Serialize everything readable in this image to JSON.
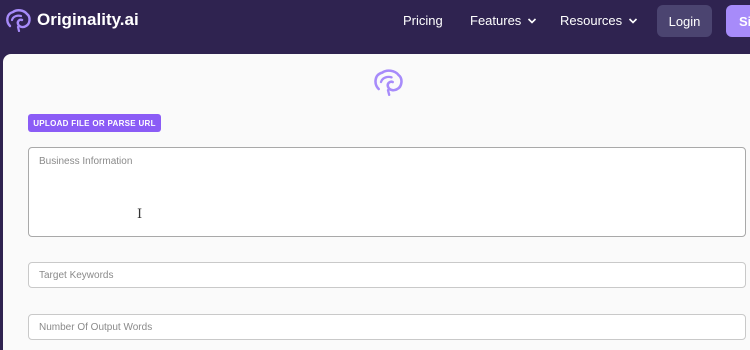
{
  "nav": {
    "brand": "Originality.ai",
    "links": [
      {
        "label": "Pricing"
      },
      {
        "label": "Features"
      },
      {
        "label": "Resources"
      }
    ],
    "login_label": "Login",
    "signup_label": "Si"
  },
  "form": {
    "upload_label": "UPLOAD FILE OR PARSE URL",
    "business_info_placeholder": "Business Information",
    "target_keywords_placeholder": "Target Keywords",
    "output_words_placeholder": "Number Of Output Words"
  },
  "colors": {
    "nav_bg": "#2f2350",
    "accent": "#8b5cf6",
    "signup_bg": "#a78bfa"
  }
}
